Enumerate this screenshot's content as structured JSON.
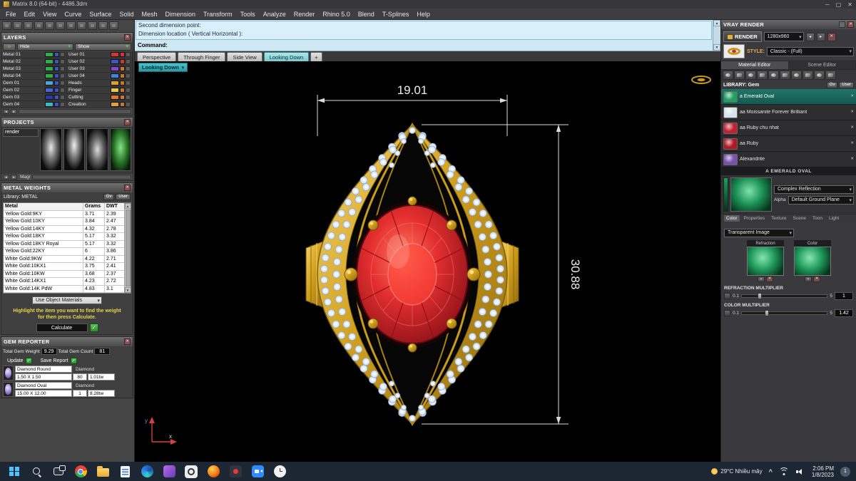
{
  "window": {
    "title": "Matrix 8.0 (64-bit) - 4486.3dm"
  },
  "menubar": {
    "items": [
      "File",
      "Edit",
      "View",
      "Curve",
      "Surface",
      "Solid",
      "Mesh",
      "Dimension",
      "Transform",
      "Tools",
      "Analyze",
      "Render",
      "Rhino 5.0",
      "Blend",
      "T-Splines",
      "Help"
    ]
  },
  "layers": {
    "title": "LAYERS",
    "hide_label": "Hide",
    "show_label": "Show",
    "left": [
      {
        "name": "Metal 01",
        "c1": "#2fae4a",
        "c2": "#3a57c8"
      },
      {
        "name": "Metal 02",
        "c1": "#2fae4a",
        "c2": "#3a57c8"
      },
      {
        "name": "Metal 03",
        "c1": "#2fae4a",
        "c2": "#3a57c8"
      },
      {
        "name": "Metal 04",
        "c1": "#2fae4a",
        "c2": "#3a57c8"
      },
      {
        "name": "Gem 01",
        "c1": "#4aa8d8",
        "c2": "#3a57c8"
      },
      {
        "name": "Gem 02",
        "c1": "#4865d8",
        "c2": "#3a57c8"
      },
      {
        "name": "Gem 03",
        "c1": "#2a3aa8",
        "c2": "#3a57c8"
      },
      {
        "name": "Gem 04",
        "c1": "#38b8c8",
        "c2": "#3a57c8"
      }
    ],
    "right": [
      {
        "name": "User 01",
        "c1": "#d63434",
        "c2": "#d63434"
      },
      {
        "name": "User 02",
        "c1": "#3a57c8",
        "c2": "#d63434"
      },
      {
        "name": "User 03",
        "c1": "#8a46c8",
        "c2": "#c87828"
      },
      {
        "name": "User 04",
        "c1": "#3a88d8",
        "c2": "#c87828"
      },
      {
        "name": "Heads",
        "c1": "#e0a030",
        "c2": "#c87828"
      },
      {
        "name": "Finger",
        "c1": "#e8c840",
        "c2": "#c87828"
      },
      {
        "name": "Cutting",
        "c1": "#e07828",
        "c2": "#c87828"
      },
      {
        "name": "Creation",
        "c1": "#e0a040",
        "c2": "#c87828"
      }
    ]
  },
  "projects": {
    "title": "PROJECTS",
    "item": "render",
    "nav_label": "Magr"
  },
  "metal_weights": {
    "title": "METAL WEIGHTS",
    "library_label": "Library:  METAL",
    "btn1": "Gv",
    "btn2": "User",
    "columns": [
      "Metal",
      "Grams",
      "DWT"
    ],
    "rows": [
      [
        "Yellow Gold:9KY",
        "3.71",
        "2.39"
      ],
      [
        "Yellow Gold:10KY",
        "3.84",
        "2.47"
      ],
      [
        "Yellow Gold:14KY",
        "4.32",
        "2.78"
      ],
      [
        "Yellow Gold:18KY",
        "5.17",
        "3.32"
      ],
      [
        "Yellow Gold:18KY Royal",
        "5.17",
        "3.32"
      ],
      [
        "Yellow Gold:22KY",
        "6",
        "3.86"
      ],
      [
        "White Gold:9KW",
        "4.22",
        "2.71"
      ],
      [
        "White Gold:10KX1",
        "3.75",
        "2.41"
      ],
      [
        "White Gold:10KW",
        "3.68",
        "2.37"
      ],
      [
        "White Gold:14KX1",
        "4.23",
        "2.72"
      ],
      [
        "White Gold:14K PdW",
        "4.83",
        "3.1"
      ]
    ],
    "materials_dropdown": "Use Object Materials",
    "hint": "Highlight the item you want to find the weight for then press Calculate.",
    "calculate_label": "Calculate"
  },
  "gem_reporter": {
    "title": "GEM REPORTER",
    "weight_label": "Total Gem Weight",
    "weight_value": "9.29",
    "count_label": "Total Gem Count",
    "count_value": "81",
    "update_label": "Update",
    "save_label": "Save Report",
    "gems": [
      {
        "name": "Diamond Round",
        "size": "1.50 X 1.50",
        "count": "80",
        "weight": "1.01tw",
        "type": "Diamond"
      },
      {
        "name": "Diamond Oval",
        "size": "15.00 X 12.00",
        "count": "1",
        "weight": "8.28tw",
        "type": "Diamond"
      }
    ]
  },
  "command": {
    "line1": "Second dimension point:",
    "line2": "Dimension location ( Vertical  Horizontal ):",
    "prompt": "Command:"
  },
  "viewport": {
    "tabs": [
      "Perspective",
      "Through Finger",
      "Side View",
      "Looking Down"
    ],
    "plus": "+",
    "label": "Looking Down",
    "dim_width": "19.01",
    "dim_height": "30.88",
    "axis_x": "x",
    "axis_y": "y"
  },
  "vray": {
    "title": "VRAY RENDER",
    "render_label": "RENDER",
    "resolution": "1280x960",
    "style_label": "STYLE:",
    "style_value": "Classic - (Full)",
    "tabs": [
      "Material Editor",
      "Scene Editor"
    ],
    "library_label": "LIBRARY: Gem",
    "lib_btn1": "Gv",
    "lib_btn2": "User",
    "materials": [
      {
        "name": "a Emerald Oval",
        "thumb": "#1fa060"
      },
      {
        "name": "aa Moissanite Forever Brilliant",
        "thumb": "#d8e4ec"
      },
      {
        "name": "aa Ruby chu nhat",
        "thumb": "#c02030"
      },
      {
        "name": "aa Ruby",
        "thumb": "#b01828"
      },
      {
        "name": "Alexandrite",
        "thumb": "#7a4fae"
      }
    ],
    "detail_title": "A EMERALD OVAL",
    "reflection_dropdown": "Complex Reflection",
    "alpha_label": "Alpha",
    "ground_dropdown": "Default Ground Plane",
    "subtabs": [
      "Color",
      "Properties",
      "Texture",
      "Scene",
      "Toon",
      "Light"
    ],
    "transparent_dropdown": "Transparent Image",
    "swatch1_label": "Refraction",
    "swatch2_label": "Color",
    "refraction": {
      "label": "REFRACTION MULTIPLIER",
      "min": "0.1",
      "max": "5",
      "value": "1"
    },
    "color": {
      "label": "COLOR MULTIPLIER",
      "min": "0.1",
      "max": "5",
      "value": "1.42"
    }
  },
  "taskbar": {
    "weather": "29°C Nhiều mây",
    "time": "2:06 PM",
    "date": "1/8/2023",
    "badge": "1"
  }
}
